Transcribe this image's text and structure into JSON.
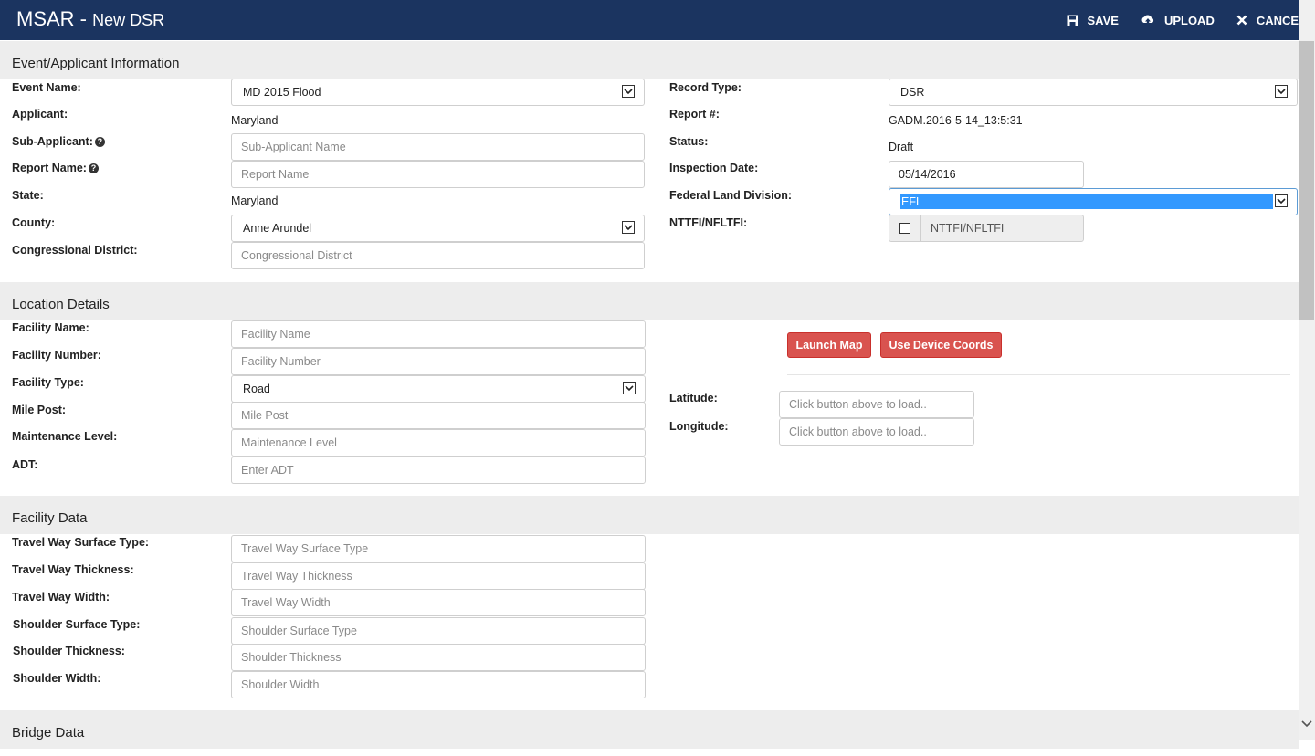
{
  "header": {
    "app_name": "MSAR",
    "separator": " - ",
    "page_title": "New DSR",
    "save_label": "SAVE",
    "upload_label": "UPLOAD",
    "cancel_label": "CANCEL",
    "icons": [
      "save-icon",
      "upload-icon",
      "close-icon"
    ]
  },
  "event_section": {
    "title": "Event/Applicant Information",
    "event_name_label": "Event Name:",
    "event_name_value": "MD 2015 Flood",
    "applicant_label": "Applicant:",
    "applicant_value": "Maryland",
    "sub_applicant_label": "Sub-Applicant:",
    "sub_applicant_placeholder": "Sub-Applicant Name",
    "report_name_label": "Report Name:",
    "report_name_placeholder": "Report Name",
    "state_label": "State:",
    "state_value": "Maryland",
    "county_label": "County:",
    "county_value": "Anne Arundel",
    "congressional_label": "Congressional District:",
    "congressional_placeholder": "Congressional District",
    "record_type_label": "Record Type:",
    "record_type_value": "DSR",
    "report_no_label": "Report #:",
    "report_no_value": "GADM.2016-5-14_13:5:31",
    "status_label": "Status:",
    "status_value": "Draft",
    "inspection_label": "Inspection Date:",
    "inspection_value": "05/14/2016",
    "fld_label": "Federal Land Division:",
    "fld_value": "EFL",
    "nttfi_label": "NTTFI/NFLTFI:",
    "nttfi_check_label": "NTTFI/NFLTFI",
    "help_glyph": "?"
  },
  "location_section": {
    "title": "Location Details",
    "facility_name_label": "Facility Name:",
    "facility_name_placeholder": "Facility Name",
    "facility_number_label": "Facility Number:",
    "facility_number_placeholder": "Facility Number",
    "facility_type_label": "Facility Type:",
    "facility_type_value": "Road",
    "mile_post_label": "Mile Post:",
    "mile_post_placeholder": "Mile Post",
    "maintenance_label": "Maintenance Level:",
    "maintenance_placeholder": "Maintenance Level",
    "adt_label": "ADT:",
    "adt_placeholder": "Enter ADT",
    "launch_map_label": "Launch Map",
    "device_coords_label": "Use Device Coords",
    "latitude_label": "Latitude:",
    "latitude_placeholder": "Click button above to load..",
    "longitude_label": "Longitude:",
    "longitude_placeholder": "Click button above to load.."
  },
  "facility_section": {
    "title": "Facility Data",
    "tw_surface_label": "Travel Way Surface Type:",
    "tw_surface_placeholder": "Travel Way Surface Type",
    "tw_thickness_label": "Travel Way Thickness:",
    "tw_thickness_placeholder": "Travel Way Thickness",
    "tw_width_label": "Travel Way Width:",
    "tw_width_placeholder": "Travel Way Width",
    "sh_surface_label": "Shoulder Surface Type:",
    "sh_surface_placeholder": "Shoulder Surface Type",
    "sh_thickness_label": "Shoulder Thickness:",
    "sh_thickness_placeholder": "Shoulder Thickness",
    "sh_width_label": "Shoulder Width:",
    "sh_width_placeholder": "Shoulder Width"
  },
  "bridge_section": {
    "title": "Bridge Data"
  }
}
